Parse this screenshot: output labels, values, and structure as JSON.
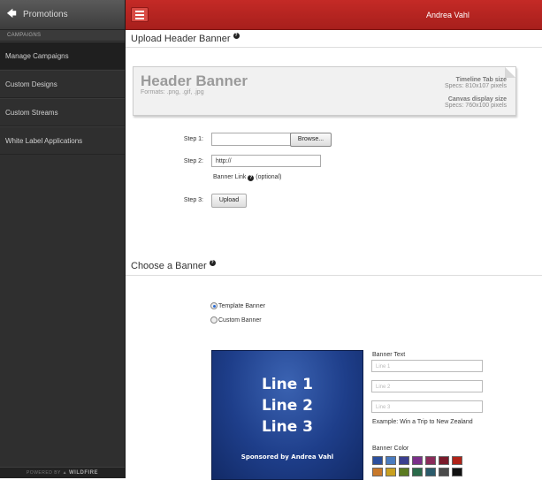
{
  "sidebar": {
    "title": "Promotions",
    "section": "CAMPAIGNS",
    "items": [
      {
        "label": "Manage Campaigns"
      },
      {
        "label": "Custom Designs"
      },
      {
        "label": "Custom Streams"
      },
      {
        "label": "White Label Applications"
      }
    ],
    "footer_prefix": "POWERED BY",
    "footer_brand": "WILDFIRE"
  },
  "topbar": {
    "user_name": "Andrea Vahl"
  },
  "upload": {
    "title": "Upload Header Banner",
    "banner_title": "Header Banner",
    "formats": "Formats: .png, .gif, .jpg",
    "timeline_head": "Timeline Tab size",
    "timeline_spec": "Specs: 810x107 pixels",
    "canvas_head": "Canvas display size",
    "canvas_spec": "Specs: 760x100 pixels",
    "step1": "Step 1:",
    "step2": "Step 2:",
    "step3": "Step 3:",
    "browse_label": "Browse...",
    "url_value": "http://",
    "banner_link_label": "Banner Link",
    "banner_link_optional": "(optional)",
    "upload_label": "Upload"
  },
  "choose": {
    "title": "Choose a Banner",
    "option_template": "Template Banner",
    "option_custom": "Custom Banner",
    "selected": "Template Banner"
  },
  "preview": {
    "line1": "Line 1",
    "line2": "Line 2",
    "line3": "Line 3",
    "sponsor": "Sponsored by Andrea Vahl"
  },
  "banner_text": {
    "label": "Banner Text",
    "placeholders": [
      "Line 1",
      "Line 2",
      "Line 3"
    ],
    "example": "Example: Win a Trip to New Zealand"
  },
  "banner_color": {
    "label": "Banner Color",
    "swatches_row1": [
      "#2b4f9e",
      "#4a7cc0",
      "#3b3f8f",
      "#7b2f8a",
      "#8a2b5a",
      "#7a1a2a",
      "#b02218"
    ],
    "swatches_row2": [
      "#c8782a",
      "#c8a020",
      "#5a7a20",
      "#2a6a4a",
      "#2a5a6a",
      "#4a4a4a",
      "#111111"
    ],
    "selected_index": 0
  },
  "colors": {
    "topbar": "#b7231f",
    "sidebar": "#2f2f2f"
  }
}
